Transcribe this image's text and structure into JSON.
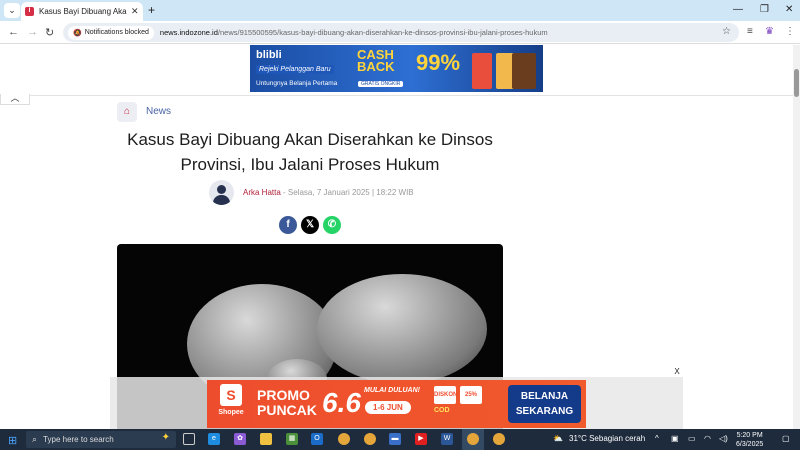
{
  "browser": {
    "tab_title": "Kasus Bayi Dibuang Akan Diserahkan ke Dinsos Provinsi",
    "notifications_chip": "Notifications blocked",
    "url_host": "news.indozone.id",
    "url_path": "/news/915500595/kasus-bayi-dibuang-akan-diserahkan-ke-dinsos-provinsi-ibu-jalani-proses-hukum"
  },
  "ads": {
    "blibli": {
      "logo": "blibli",
      "tagline": "Rejeki Pelanggan Baru",
      "line": "Untungnya Belanja Pertama",
      "cash": "CASH BACK",
      "number": "99%",
      "badge": "GRATIS ONGKIR"
    },
    "shopee": {
      "brand": "Shopee",
      "promo": "PROMO PUNCAK",
      "number": "6.6",
      "mulai": "MULAI DULUAN!",
      "dates": "1-6 JUN",
      "badge1": "DISKON",
      "badge2": "25%",
      "cod": "COD",
      "cta": "BELANJA SEKARANG",
      "close": "X"
    }
  },
  "article": {
    "category": "News",
    "headline": "Kasus Bayi Dibuang Akan Diserahkan ke Dinsos Provinsi, Ibu Jalani Proses Hukum",
    "author": "Arka Hatta",
    "date": "- Selasa, 7 Januari 2025 | 18:22 WIB"
  },
  "taskbar": {
    "search_placeholder": "Type here to search",
    "weather": "31°C  Sebagian cerah",
    "time": "5:20 PM",
    "date": "6/3/2025"
  },
  "colors": {
    "brand_red": "#c4213a",
    "facebook": "#3b5998",
    "x": "#000000",
    "whatsapp": "#25d366",
    "shopee": "#ee4d2d"
  }
}
